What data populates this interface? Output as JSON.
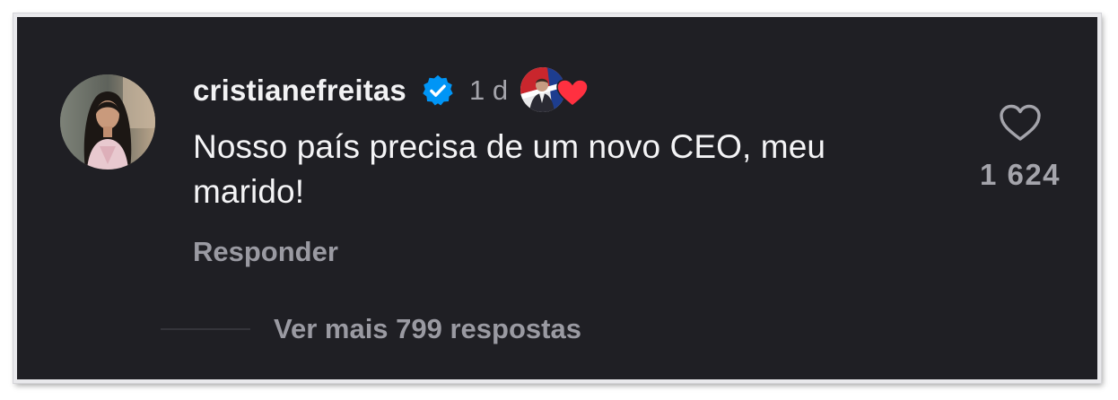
{
  "comment": {
    "username": "cristianefreitas",
    "verified": true,
    "time": "1 d",
    "text": "Nosso país precisa de um novo CEO, meu marido!",
    "reply_label": "Responder",
    "like_count": "1 624",
    "more_replies_label": "Ver mais 799 respostas",
    "liked_by_author_icon": "heart-icon"
  },
  "colors": {
    "background": "#1f1f24",
    "text_primary": "#f4f4f6",
    "text_secondary": "#9a9aa2",
    "verified_blue": "#0095f6",
    "heart_red": "#ff3040"
  }
}
